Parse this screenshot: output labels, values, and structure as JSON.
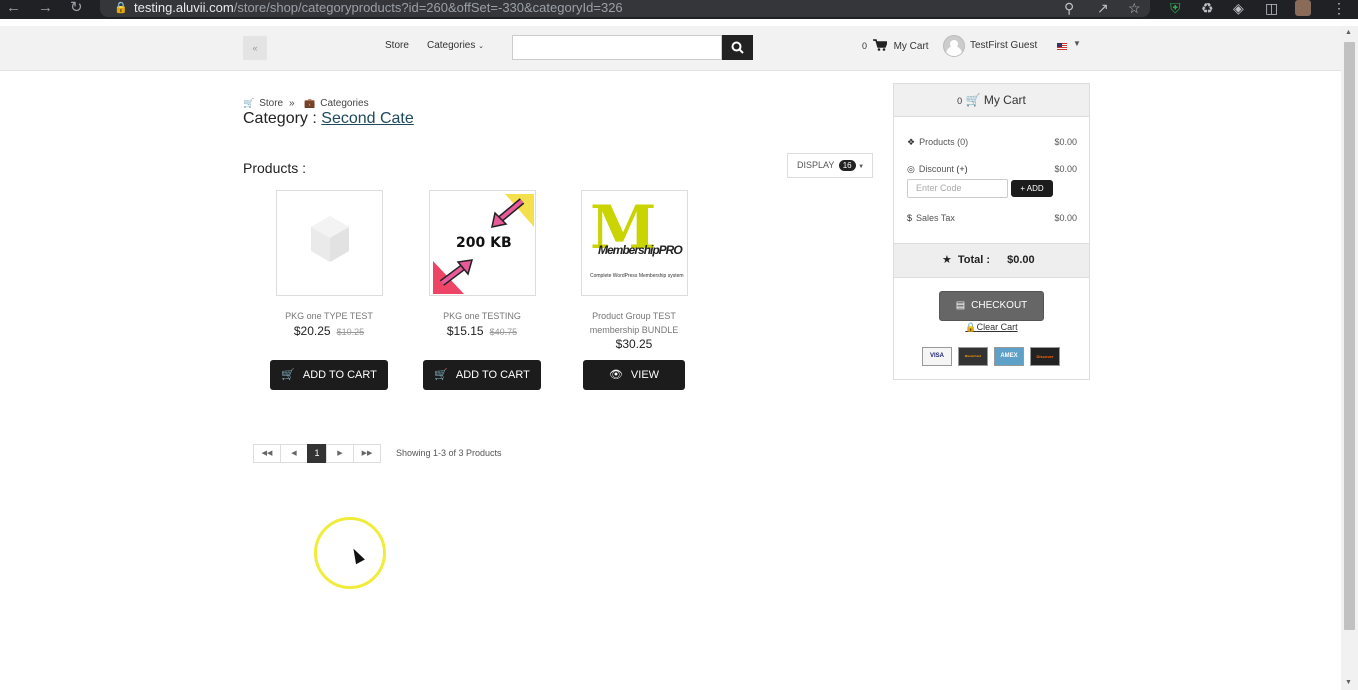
{
  "browser": {
    "url_host": "testing.aluvii.com",
    "url_path": "/store/shop/categoryproducts?id=260&offSet=-330&categoryId=326"
  },
  "topbar": {
    "store_label": "Store",
    "categories_label": "Categories",
    "cart_count": "0",
    "cart_label": "My Cart",
    "user_name": "TestFirst Guest"
  },
  "breadcrumb": {
    "store": "Store",
    "separator": "»",
    "categories": "Categories"
  },
  "category": {
    "prefix": "Category :",
    "name": "Second Cate"
  },
  "products_heading": "Products :",
  "display": {
    "label": "DISPLAY",
    "count": "16"
  },
  "products": [
    {
      "name": "PKG one TYPE TEST",
      "price": "$20.25",
      "old_price": "$10.25",
      "button": "ADD TO CART",
      "image": "placeholder-box"
    },
    {
      "name": "PKG one TESTING",
      "price": "$15.15",
      "old_price": "$40.75",
      "button": "ADD TO CART",
      "image_text": "200 KB"
    },
    {
      "name_line1": "Product Group TEST",
      "name_line2": "membership BUNDLE",
      "price": "$30.25",
      "button": "VIEW",
      "image_text_main": "MembershipPRO",
      "image_text_sub": "Complete WordPress Membership system"
    }
  ],
  "pagination": {
    "current_page": "1",
    "showing": "Showing 1-3 of 3 Products"
  },
  "cart": {
    "count": "0",
    "title": "My Cart",
    "products_label": "Products (0)",
    "products_amount": "$0.00",
    "discount_label": "Discount",
    "discount_plus": "(+)",
    "discount_amount": "$0.00",
    "code_placeholder": "Enter Code",
    "add_label": "ADD",
    "tax_label": "Sales Tax",
    "tax_amount": "$0.00",
    "total_label": "Total :",
    "total_amount": "$0.00",
    "checkout_label": "CHECKOUT",
    "clear_label": "Clear Cart",
    "payment_cards": [
      "VISA",
      "MasterCard",
      "AMEX",
      "Discover"
    ]
  }
}
